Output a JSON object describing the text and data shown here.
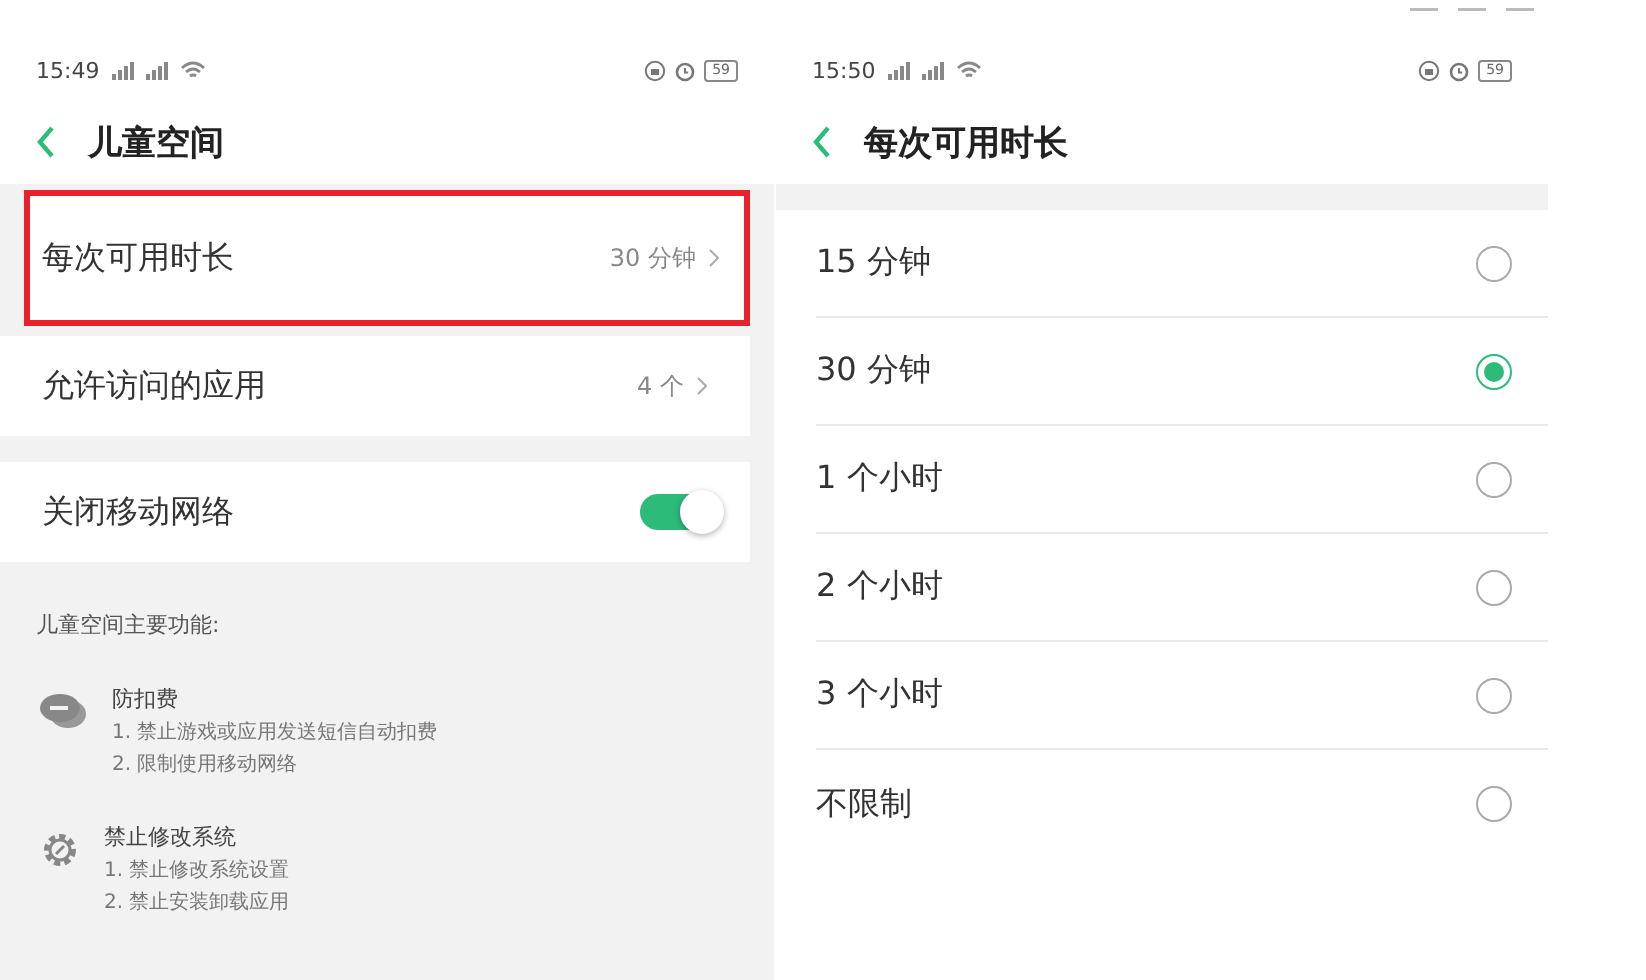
{
  "left_screen": {
    "status_bar": {
      "time": "15:49",
      "battery": "59"
    },
    "title": "儿童空间",
    "settings": [
      {
        "kind": "value",
        "label": "每次可用时长",
        "value": "30 分钟",
        "highlighted": true
      },
      {
        "kind": "value",
        "label": "允许访问的应用",
        "value": "4 个",
        "highlighted": false
      },
      {
        "kind": "switch",
        "label": "关闭移动网络",
        "on": true,
        "highlighted": false
      }
    ],
    "features_heading": "儿童空间主要功能:",
    "features": [
      {
        "kind": "chat",
        "title": "防扣费",
        "lines": [
          "1. 禁止游戏或应用发送短信自动扣费",
          "2. 限制使用移动网络"
        ]
      },
      {
        "kind": "gear",
        "title": "禁止修改系统",
        "lines": [
          "1. 禁止修改系统设置",
          "2. 禁止安装卸载应用"
        ]
      }
    ]
  },
  "right_screen": {
    "status_bar": {
      "time": "15:50",
      "battery": "59"
    },
    "title": "每次可用时长",
    "options": [
      {
        "label": "15 分钟",
        "selected": false
      },
      {
        "label": "30 分钟",
        "selected": true
      },
      {
        "label": "1 个小时",
        "selected": false
      },
      {
        "label": "2 个小时",
        "selected": false
      },
      {
        "label": "3 个小时",
        "selected": false
      },
      {
        "label": "不限制",
        "selected": false
      }
    ]
  }
}
